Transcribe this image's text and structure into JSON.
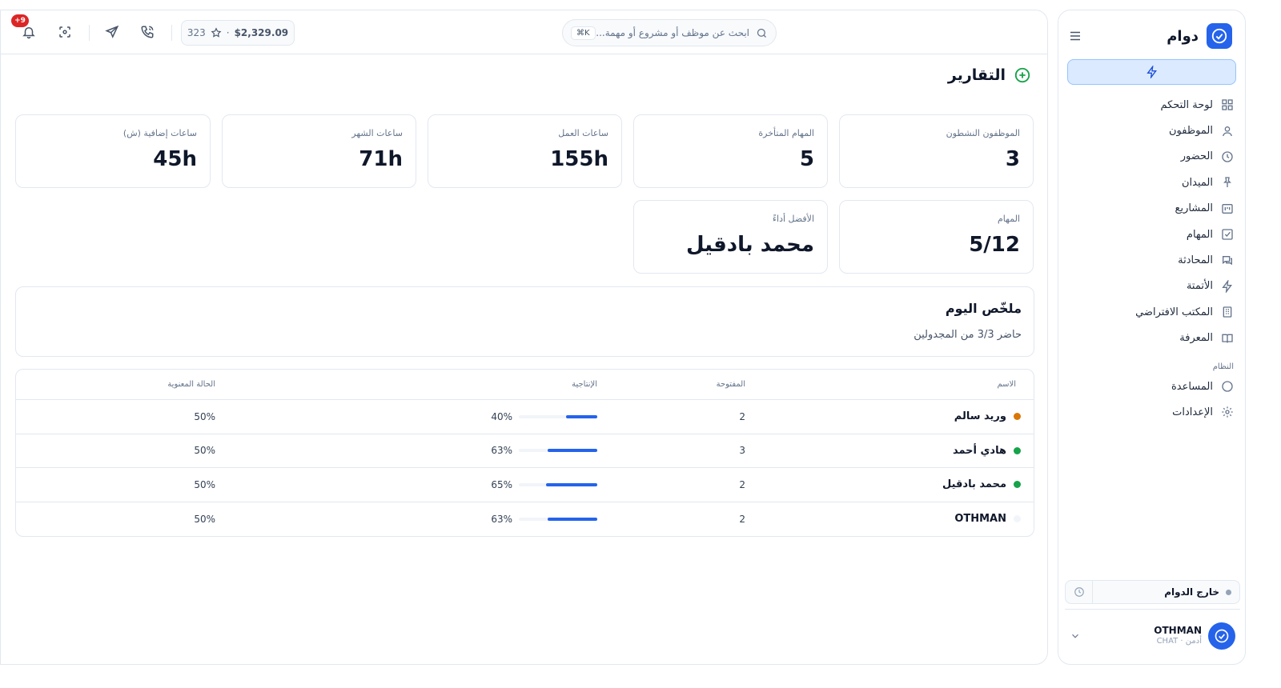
{
  "sidebar": {
    "brand": "دوام",
    "items": [
      {
        "label": "لوحة التحكم",
        "icon": "grid-icon"
      },
      {
        "label": "الموظفون",
        "icon": "user-icon"
      },
      {
        "label": "الحضور",
        "icon": "clock-icon"
      },
      {
        "label": "الميدان",
        "icon": "pin-icon"
      },
      {
        "label": "المشاريع",
        "icon": "kanban-icon"
      },
      {
        "label": "المهام",
        "icon": "check-square-icon"
      },
      {
        "label": "المحادثة",
        "icon": "chat-icon"
      },
      {
        "label": "الأتمتة",
        "icon": "bolt-icon"
      },
      {
        "label": "المكتب الافتراضي",
        "icon": "building-icon"
      },
      {
        "label": "المعرفة",
        "icon": "book-icon"
      }
    ],
    "system_section": "النظام",
    "system_items": [
      {
        "label": "المساعدة",
        "icon": "help-circle-icon"
      },
      {
        "label": "الإعدادات",
        "icon": "gear-icon"
      }
    ],
    "shift_status": "خارج الدوام",
    "user": {
      "name": "OTHMAN",
      "role": "أدمن · CHAT"
    }
  },
  "topbar": {
    "search_placeholder": "ابحث عن موظف أو مشروع أو مهمة...",
    "search_shortcut": "⌘K",
    "wallet_amount": "$2,329.09",
    "wallet_sep": "·",
    "points": "323",
    "notifications_badge": "+9"
  },
  "page": {
    "title": "التقارير"
  },
  "stats": [
    {
      "label": "الموظفون النشطون",
      "value": "3"
    },
    {
      "label": "المهام المتأخرة",
      "value": "5"
    },
    {
      "label": "ساعات العمل",
      "value": "155h"
    },
    {
      "label": "ساعات الشهر",
      "value": "71h"
    },
    {
      "label": "ساعات إضافية (ش)",
      "value": "45h"
    },
    {
      "label": "المهام",
      "value": "5/12"
    },
    {
      "label": "الأفضل أداءً",
      "value": "محمد بادقيل"
    }
  ],
  "summary": {
    "title": "ملخّص اليوم",
    "text": "حاضر 3/3 من المجدولين"
  },
  "table": {
    "headers": {
      "name": "الاسم",
      "open": "المفتوحة",
      "productivity": "الإنتاجية",
      "morale": "الحالة المعنوية"
    },
    "rows": [
      {
        "name": "وريد سالم",
        "status_color": "#d97706",
        "open": "2",
        "productivity": "40%",
        "productivity_value": 40,
        "morale": "50%"
      },
      {
        "name": "هادي أحمد",
        "status_color": "#16a34a",
        "open": "3",
        "productivity": "63%",
        "productivity_value": 63,
        "morale": "50%"
      },
      {
        "name": "محمد بادقيل",
        "status_color": "#16a34a",
        "open": "2",
        "productivity": "65%",
        "productivity_value": 65,
        "morale": "50%"
      },
      {
        "name": "OTHMAN",
        "status_color": "#f1f5f9",
        "open": "2",
        "productivity": "63%",
        "productivity_value": 63,
        "morale": "50%"
      }
    ]
  },
  "colors": {
    "accent": "#2563eb",
    "danger": "#dc2626",
    "success": "#16a34a"
  }
}
